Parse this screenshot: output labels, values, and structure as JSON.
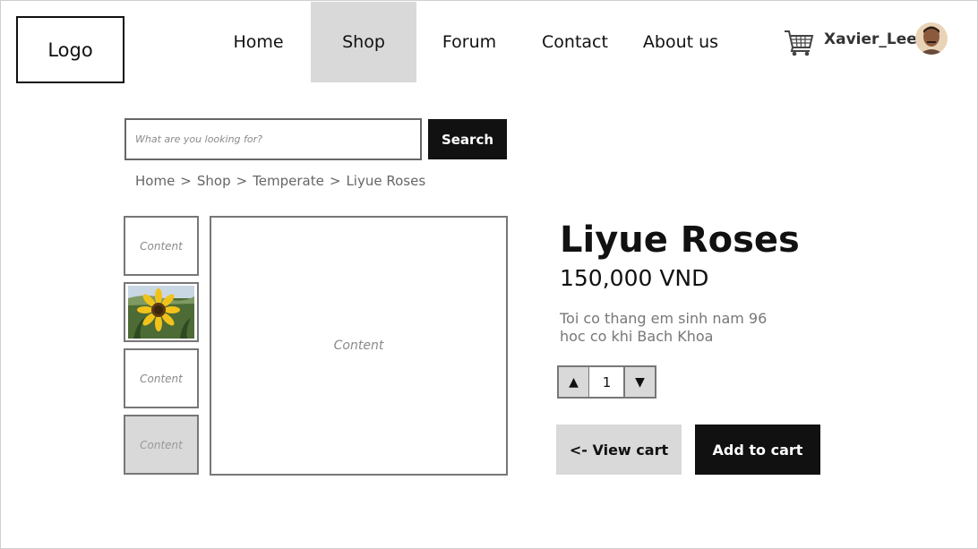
{
  "header": {
    "logo": "Logo",
    "nav": [
      {
        "label": "Home",
        "active": false
      },
      {
        "label": "Shop",
        "active": true
      },
      {
        "label": "Forum",
        "active": false
      },
      {
        "label": "Contact",
        "active": false
      },
      {
        "label": "About us",
        "active": false
      }
    ],
    "cart_icon": "shopping-cart-icon",
    "username": "Xavier_Lee",
    "avatar": "user-avatar"
  },
  "search": {
    "placeholder": "What are you looking for?",
    "button_label": "Search"
  },
  "breadcrumb": [
    "Home",
    "Shop",
    "Temperate",
    "Liyue Roses"
  ],
  "breadcrumb_separator": ">",
  "gallery": {
    "thumbnails": [
      {
        "label": "Content",
        "kind": "placeholder"
      },
      {
        "label": "",
        "kind": "sunflower-photo"
      },
      {
        "label": "Content",
        "kind": "placeholder"
      },
      {
        "label": "Content",
        "kind": "placeholder-shaded"
      }
    ],
    "main_label": "Content"
  },
  "product": {
    "title": "Liyue Roses",
    "price": "150,000 VND",
    "description_line1": "Toi co thang em sinh nam 96",
    "description_line2": "hoc co khi Bach Khoa",
    "quantity": "1",
    "qty_up_symbol": "▲",
    "qty_down_symbol": "▼"
  },
  "actions": {
    "view_cart": "<- View cart",
    "add_to_cart": "Add to cart"
  },
  "colors": {
    "active_nav": "#d9d9d9",
    "dark_button": "#111111",
    "light_button": "#d9d9d9"
  }
}
